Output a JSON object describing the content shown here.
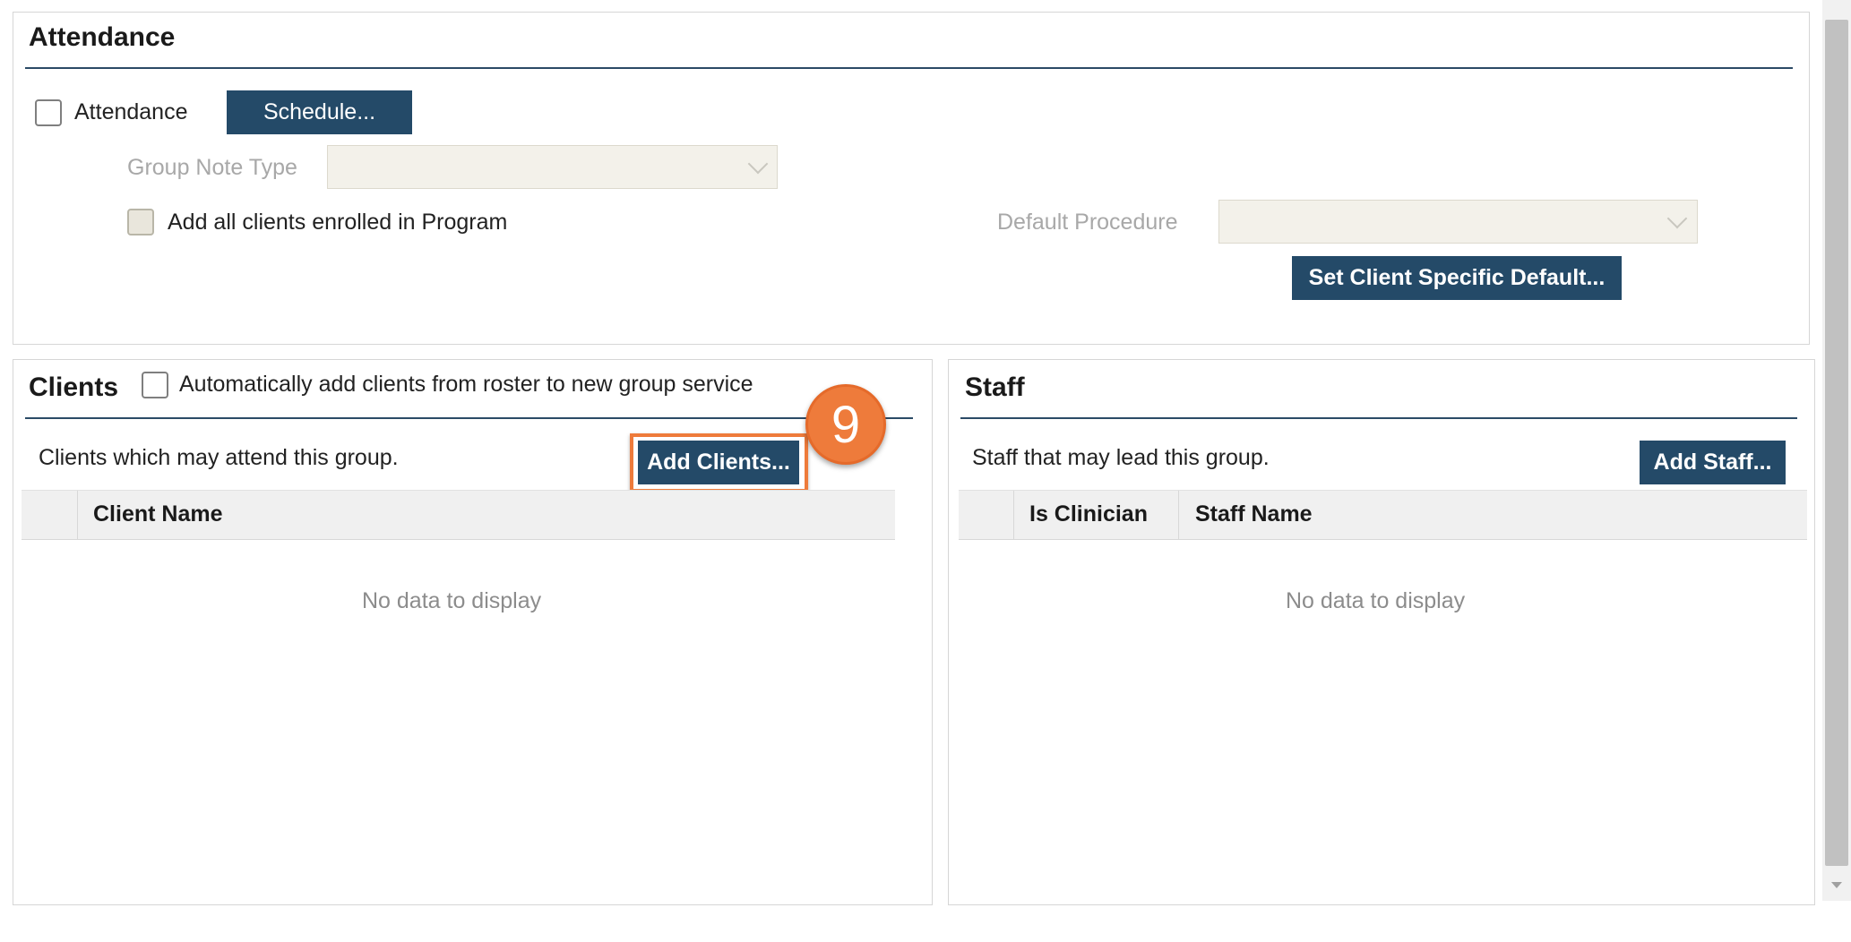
{
  "attendance": {
    "title": "Attendance",
    "attendance_checkbox_label": "Attendance",
    "schedule_button": "Schedule...",
    "group_note_type_label": "Group Note Type",
    "group_note_type_value": "",
    "add_all_clients_label": "Add all clients enrolled in Program",
    "default_procedure_label": "Default Procedure",
    "default_procedure_value": "",
    "set_default_button": "Set Client Specific Default..."
  },
  "clients": {
    "title": "Clients",
    "auto_add_label": "Automatically add clients from roster to new group service",
    "description": "Clients which may attend this group.",
    "add_button": "Add Clients...",
    "columns": [
      "Client Name"
    ],
    "empty_text": "No data to display"
  },
  "staff": {
    "title": "Staff",
    "description": "Staff that may lead this group.",
    "add_button": "Add Staff...",
    "columns": [
      "Is Clinician",
      "Staff Name"
    ],
    "empty_text": "No data to display"
  },
  "step_badge": "9",
  "colors": {
    "button_bg": "#244a68",
    "highlight": "#ee7b3b"
  }
}
